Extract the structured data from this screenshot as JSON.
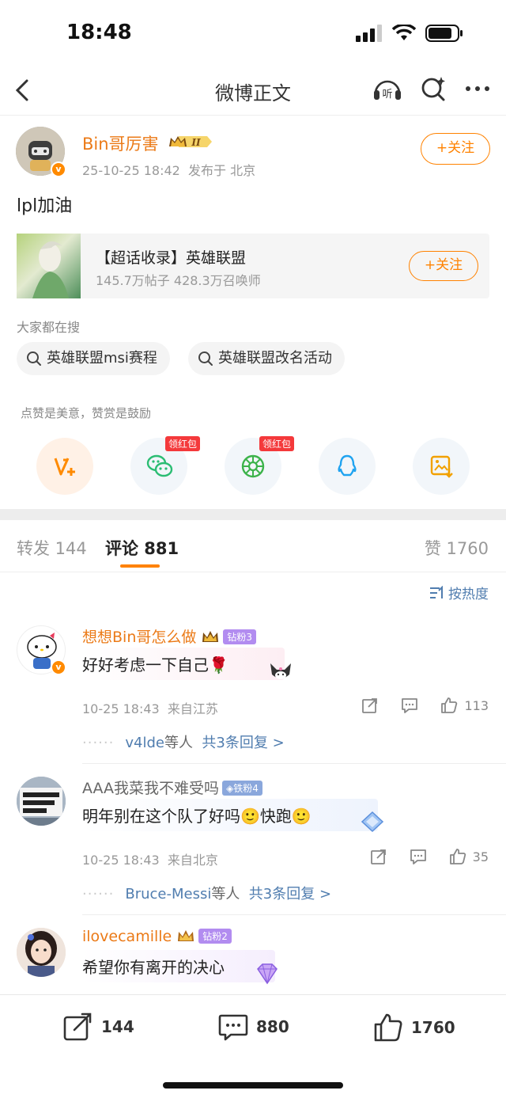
{
  "status": {
    "time": "18:48"
  },
  "nav": {
    "title": "微博正文"
  },
  "post": {
    "author": "Bin哥厉害",
    "crown_badge": "II",
    "date": "25-10-25 18:42",
    "location": "发布于 北京",
    "follow_label": "+关注",
    "text": "lpl加油"
  },
  "topic": {
    "title": "【超话收录】英雄联盟",
    "stats": "145.7万帖子 428.3万召唤师",
    "follow_label": "+关注"
  },
  "search": {
    "label": "大家都在搜",
    "chips": [
      "英雄联盟msi赛程",
      "英雄联盟改名活动"
    ]
  },
  "share": {
    "hint": "点赞是美意，赞赏是鼓励",
    "redpack_label": "领红包"
  },
  "tabs": {
    "repost": "转发 144",
    "comment": "评论 881",
    "like": "赞 1760"
  },
  "sort": {
    "label": "按热度"
  },
  "comments": [
    {
      "name": "想想Bin哥怎么做",
      "fan_badge": "钻粉3",
      "text": "好好考虑一下自己🌹",
      "date": "10-25 18:43",
      "location": "来自江苏",
      "likes": "113",
      "reply_user": "v4lde",
      "reply_others": "等人",
      "reply_count": "共3条回复 >"
    },
    {
      "name": "AAA我菜我不难受吗",
      "fan_badge": "铁粉4",
      "text": "明年别在这个队了好吗🙂快跑🙂",
      "date": "10-25 18:43",
      "location": "来自北京",
      "likes": "35",
      "reply_user": "Bruce-Messi",
      "reply_others": "等人",
      "reply_count": "共3条回复 >"
    },
    {
      "name": "ilovecamille",
      "fan_badge": "钻粉2",
      "text": "希望你有离开的决心"
    }
  ],
  "bottom": {
    "repost": "144",
    "comment": "880",
    "like": "1760"
  },
  "colors": {
    "accent": "#ff8200",
    "link": "#507daf"
  }
}
